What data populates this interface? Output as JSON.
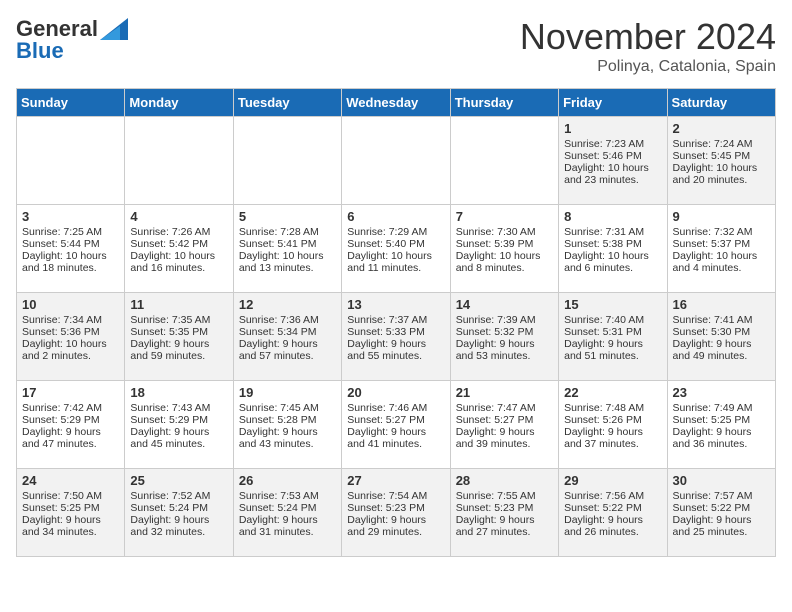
{
  "logo": {
    "general": "General",
    "blue": "Blue"
  },
  "title": "November 2024",
  "location": "Polinya, Catalonia, Spain",
  "days_of_week": [
    "Sunday",
    "Monday",
    "Tuesday",
    "Wednesday",
    "Thursday",
    "Friday",
    "Saturday"
  ],
  "weeks": [
    [
      {
        "day": "",
        "sunrise": "",
        "sunset": "",
        "daylight": ""
      },
      {
        "day": "",
        "sunrise": "",
        "sunset": "",
        "daylight": ""
      },
      {
        "day": "",
        "sunrise": "",
        "sunset": "",
        "daylight": ""
      },
      {
        "day": "",
        "sunrise": "",
        "sunset": "",
        "daylight": ""
      },
      {
        "day": "",
        "sunrise": "",
        "sunset": "",
        "daylight": ""
      },
      {
        "day": "1",
        "sunrise": "Sunrise: 7:23 AM",
        "sunset": "Sunset: 5:46 PM",
        "daylight": "Daylight: 10 hours and 23 minutes."
      },
      {
        "day": "2",
        "sunrise": "Sunrise: 7:24 AM",
        "sunset": "Sunset: 5:45 PM",
        "daylight": "Daylight: 10 hours and 20 minutes."
      }
    ],
    [
      {
        "day": "3",
        "sunrise": "Sunrise: 7:25 AM",
        "sunset": "Sunset: 5:44 PM",
        "daylight": "Daylight: 10 hours and 18 minutes."
      },
      {
        "day": "4",
        "sunrise": "Sunrise: 7:26 AM",
        "sunset": "Sunset: 5:42 PM",
        "daylight": "Daylight: 10 hours and 16 minutes."
      },
      {
        "day": "5",
        "sunrise": "Sunrise: 7:28 AM",
        "sunset": "Sunset: 5:41 PM",
        "daylight": "Daylight: 10 hours and 13 minutes."
      },
      {
        "day": "6",
        "sunrise": "Sunrise: 7:29 AM",
        "sunset": "Sunset: 5:40 PM",
        "daylight": "Daylight: 10 hours and 11 minutes."
      },
      {
        "day": "7",
        "sunrise": "Sunrise: 7:30 AM",
        "sunset": "Sunset: 5:39 PM",
        "daylight": "Daylight: 10 hours and 8 minutes."
      },
      {
        "day": "8",
        "sunrise": "Sunrise: 7:31 AM",
        "sunset": "Sunset: 5:38 PM",
        "daylight": "Daylight: 10 hours and 6 minutes."
      },
      {
        "day": "9",
        "sunrise": "Sunrise: 7:32 AM",
        "sunset": "Sunset: 5:37 PM",
        "daylight": "Daylight: 10 hours and 4 minutes."
      }
    ],
    [
      {
        "day": "10",
        "sunrise": "Sunrise: 7:34 AM",
        "sunset": "Sunset: 5:36 PM",
        "daylight": "Daylight: 10 hours and 2 minutes."
      },
      {
        "day": "11",
        "sunrise": "Sunrise: 7:35 AM",
        "sunset": "Sunset: 5:35 PM",
        "daylight": "Daylight: 9 hours and 59 minutes."
      },
      {
        "day": "12",
        "sunrise": "Sunrise: 7:36 AM",
        "sunset": "Sunset: 5:34 PM",
        "daylight": "Daylight: 9 hours and 57 minutes."
      },
      {
        "day": "13",
        "sunrise": "Sunrise: 7:37 AM",
        "sunset": "Sunset: 5:33 PM",
        "daylight": "Daylight: 9 hours and 55 minutes."
      },
      {
        "day": "14",
        "sunrise": "Sunrise: 7:39 AM",
        "sunset": "Sunset: 5:32 PM",
        "daylight": "Daylight: 9 hours and 53 minutes."
      },
      {
        "day": "15",
        "sunrise": "Sunrise: 7:40 AM",
        "sunset": "Sunset: 5:31 PM",
        "daylight": "Daylight: 9 hours and 51 minutes."
      },
      {
        "day": "16",
        "sunrise": "Sunrise: 7:41 AM",
        "sunset": "Sunset: 5:30 PM",
        "daylight": "Daylight: 9 hours and 49 minutes."
      }
    ],
    [
      {
        "day": "17",
        "sunrise": "Sunrise: 7:42 AM",
        "sunset": "Sunset: 5:29 PM",
        "daylight": "Daylight: 9 hours and 47 minutes."
      },
      {
        "day": "18",
        "sunrise": "Sunrise: 7:43 AM",
        "sunset": "Sunset: 5:29 PM",
        "daylight": "Daylight: 9 hours and 45 minutes."
      },
      {
        "day": "19",
        "sunrise": "Sunrise: 7:45 AM",
        "sunset": "Sunset: 5:28 PM",
        "daylight": "Daylight: 9 hours and 43 minutes."
      },
      {
        "day": "20",
        "sunrise": "Sunrise: 7:46 AM",
        "sunset": "Sunset: 5:27 PM",
        "daylight": "Daylight: 9 hours and 41 minutes."
      },
      {
        "day": "21",
        "sunrise": "Sunrise: 7:47 AM",
        "sunset": "Sunset: 5:27 PM",
        "daylight": "Daylight: 9 hours and 39 minutes."
      },
      {
        "day": "22",
        "sunrise": "Sunrise: 7:48 AM",
        "sunset": "Sunset: 5:26 PM",
        "daylight": "Daylight: 9 hours and 37 minutes."
      },
      {
        "day": "23",
        "sunrise": "Sunrise: 7:49 AM",
        "sunset": "Sunset: 5:25 PM",
        "daylight": "Daylight: 9 hours and 36 minutes."
      }
    ],
    [
      {
        "day": "24",
        "sunrise": "Sunrise: 7:50 AM",
        "sunset": "Sunset: 5:25 PM",
        "daylight": "Daylight: 9 hours and 34 minutes."
      },
      {
        "day": "25",
        "sunrise": "Sunrise: 7:52 AM",
        "sunset": "Sunset: 5:24 PM",
        "daylight": "Daylight: 9 hours and 32 minutes."
      },
      {
        "day": "26",
        "sunrise": "Sunrise: 7:53 AM",
        "sunset": "Sunset: 5:24 PM",
        "daylight": "Daylight: 9 hours and 31 minutes."
      },
      {
        "day": "27",
        "sunrise": "Sunrise: 7:54 AM",
        "sunset": "Sunset: 5:23 PM",
        "daylight": "Daylight: 9 hours and 29 minutes."
      },
      {
        "day": "28",
        "sunrise": "Sunrise: 7:55 AM",
        "sunset": "Sunset: 5:23 PM",
        "daylight": "Daylight: 9 hours and 27 minutes."
      },
      {
        "day": "29",
        "sunrise": "Sunrise: 7:56 AM",
        "sunset": "Sunset: 5:22 PM",
        "daylight": "Daylight: 9 hours and 26 minutes."
      },
      {
        "day": "30",
        "sunrise": "Sunrise: 7:57 AM",
        "sunset": "Sunset: 5:22 PM",
        "daylight": "Daylight: 9 hours and 25 minutes."
      }
    ]
  ]
}
